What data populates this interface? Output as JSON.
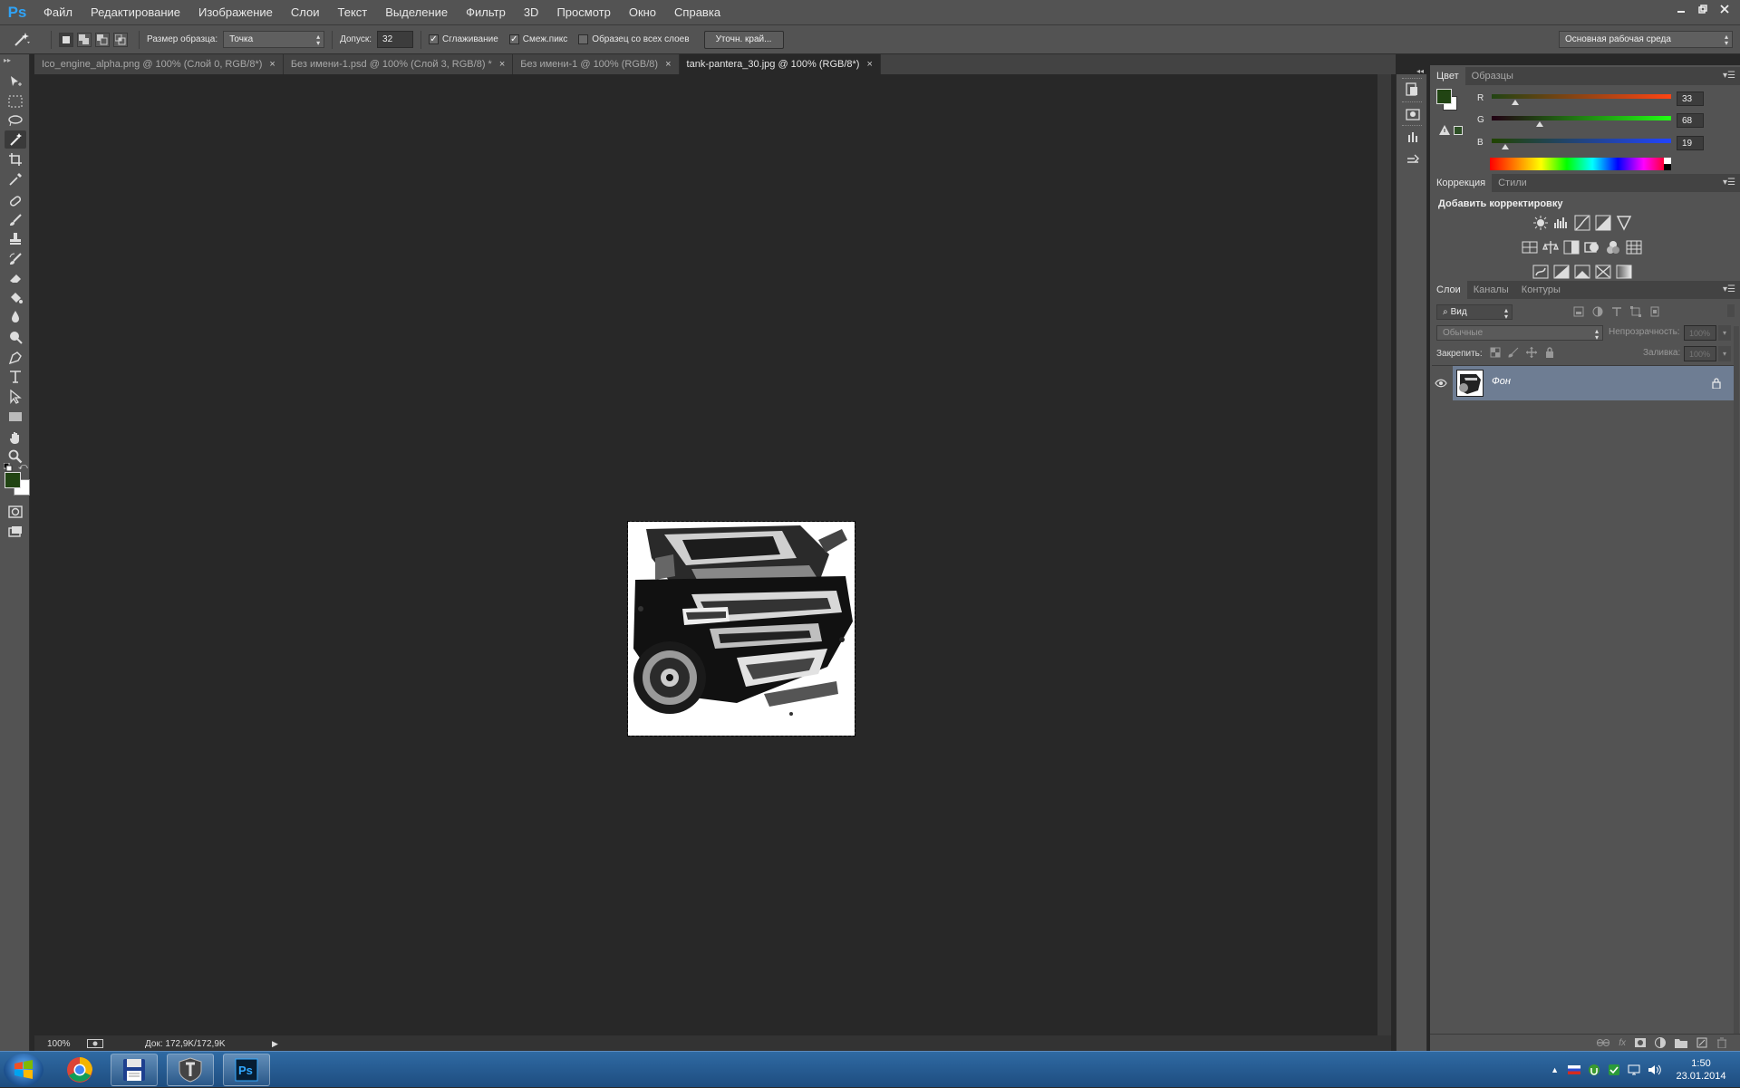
{
  "app": {
    "logo": "Ps",
    "menu": [
      "Файл",
      "Редактирование",
      "Изображение",
      "Слои",
      "Текст",
      "Выделение",
      "Фильтр",
      "3D",
      "Просмотр",
      "Окно",
      "Справка"
    ],
    "window_controls": [
      "minimize-icon",
      "restore-icon",
      "close-icon"
    ]
  },
  "options_bar": {
    "sample_size_label": "Размер образца:",
    "sample_size_value": "Точка",
    "tolerance_label": "Допуск:",
    "tolerance_value": "32",
    "antialias_label": "Сглаживание",
    "antialias_checked": true,
    "contiguous_label": "Смеж.пикс",
    "contiguous_checked": true,
    "all_layers_label": "Образец со всех слоев",
    "all_layers_checked": false,
    "refine_button": "Уточн. край...",
    "workspace_value": "Основная рабочая среда"
  },
  "tabs": [
    {
      "label": "Ico_engine_alpha.png @ 100% (Слой 0, RGB/8*)",
      "active": false
    },
    {
      "label": "Без имени-1.psd @ 100% (Слой 3, RGB/8) *",
      "active": false
    },
    {
      "label": "Без имени-1 @ 100% (RGB/8)",
      "active": false
    },
    {
      "label": "tank-pantera_30.jpg @ 100% (RGB/8*)",
      "active": true
    }
  ],
  "tools": [
    "move-icon",
    "marquee-icon",
    "lasso-icon",
    "magic-wand-icon",
    "crop-icon",
    "eyedropper-icon",
    "healing-brush-icon",
    "brush-icon",
    "clone-stamp-icon",
    "history-brush-icon",
    "eraser-icon",
    "paint-bucket-icon",
    "blur-icon",
    "dodge-icon",
    "pen-icon",
    "type-icon",
    "path-selection-icon",
    "rectangle-icon",
    "hand-icon",
    "zoom-icon"
  ],
  "active_tool": "magic-wand-icon",
  "status": {
    "zoom": "100%",
    "doc_size": "Док: 172,9K/172,9K"
  },
  "color_panel": {
    "tabs": [
      "Цвет",
      "Образцы"
    ],
    "foreground": "#214413",
    "background": "#ffffff",
    "channels": [
      {
        "label": "R",
        "value": "33",
        "fraction": 0.129
      },
      {
        "label": "G",
        "value": "68",
        "fraction": 0.267
      },
      {
        "label": "B",
        "value": "19",
        "fraction": 0.075
      }
    ]
  },
  "adjustments_panel": {
    "tabs": [
      "Коррекция",
      "Стили"
    ],
    "title": "Добавить корректировку",
    "icons": [
      [
        "brightness-contrast-icon",
        "levels-icon",
        "curves-icon",
        "exposure-icon",
        "vibrance-icon"
      ],
      [
        "hue-saturation-icon",
        "color-balance-icon",
        "black-white-icon",
        "photo-filter-icon",
        "channel-mixer-icon",
        "color-lookup-icon"
      ],
      [
        "invert-icon",
        "posterize-icon",
        "threshold-icon",
        "selective-color-icon",
        "gradient-map-icon"
      ]
    ]
  },
  "layers_panel": {
    "tabs": [
      "Слои",
      "Каналы",
      "Контуры"
    ],
    "filter_label": "Вид",
    "blend_mode": "Обычные",
    "opacity_label": "Непрозрачность:",
    "opacity_value": "100%",
    "lock_label": "Закрепить:",
    "fill_label": "Заливка:",
    "fill_value": "100%",
    "layers": [
      {
        "name": "Фон",
        "visible": true,
        "locked": true,
        "selected": true
      }
    ]
  },
  "taskbar": {
    "apps": [
      "chrome-icon",
      "save-icon",
      "world-of-tanks-icon",
      "photoshop-icon"
    ],
    "tray_lang": "RU",
    "time": "1:50",
    "date": "23.01.2014"
  }
}
